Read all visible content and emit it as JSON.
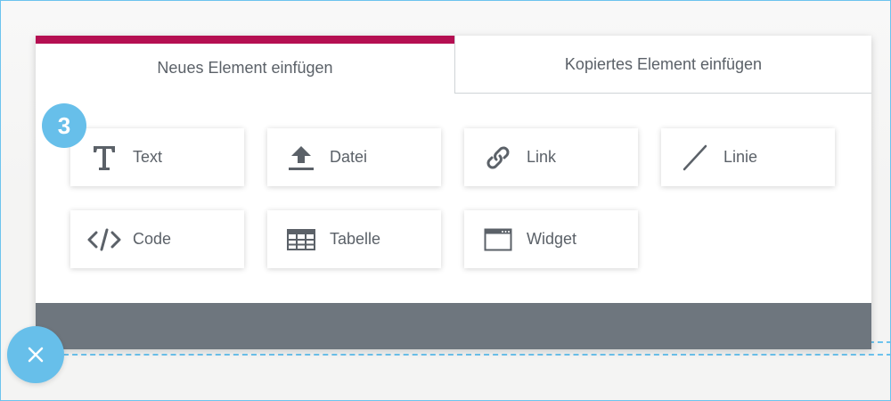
{
  "tabs": {
    "new_label": "Neues Element einfügen",
    "copy_label": "Kopiertes Element einfügen"
  },
  "elements": [
    {
      "label": "Text",
      "icon": "text-icon"
    },
    {
      "label": "Datei",
      "icon": "upload-icon"
    },
    {
      "label": "Link",
      "icon": "link-icon"
    },
    {
      "label": "Linie",
      "icon": "line-icon"
    },
    {
      "label": "Code",
      "icon": "code-icon"
    },
    {
      "label": "Tabelle",
      "icon": "table-icon"
    },
    {
      "label": "Widget",
      "icon": "widget-icon"
    }
  ],
  "step_badge": "3",
  "colors": {
    "accent": "#b50f52",
    "highlight": "#67bfea",
    "footer": "#6e767e",
    "text": "#5b6168"
  }
}
